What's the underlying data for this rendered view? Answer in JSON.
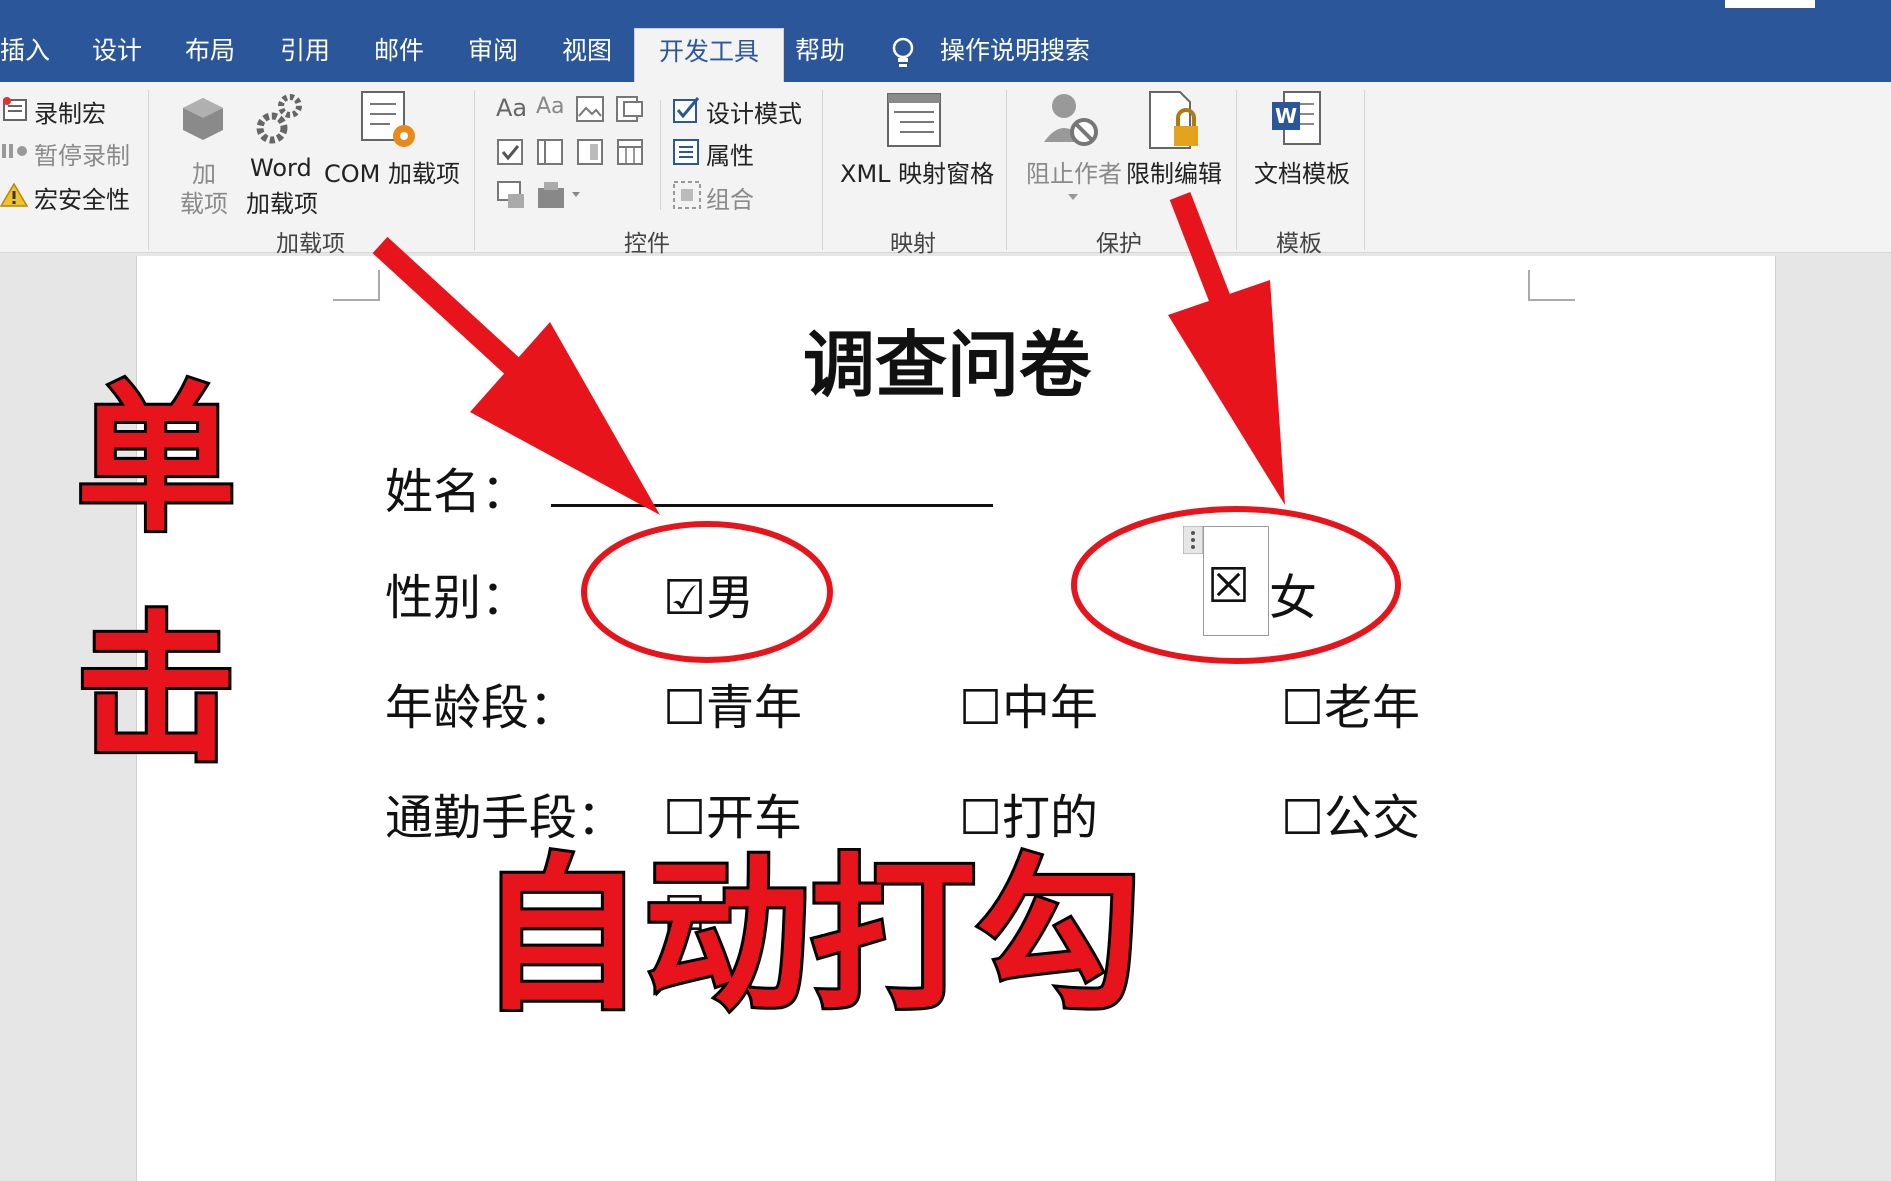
{
  "tabs": {
    "insert": "插入",
    "design": "设计",
    "layout": "布局",
    "references": "引用",
    "mailings": "邮件",
    "review": "审阅",
    "view": "视图",
    "developer": "开发工具",
    "help": "帮助",
    "tell_me": "操作说明搜索"
  },
  "ribbon": {
    "code": {
      "record_macro": "录制宏",
      "pause_recording": "暂停录制",
      "macro_security": "宏安全性"
    },
    "addins": {
      "addins_line1": "加",
      "addins_line2": "载项",
      "word_line1": "Word",
      "word_line2": "加载项",
      "com": "COM 加载项",
      "group_label": "加载项"
    },
    "controls": {
      "design_mode": "设计模式",
      "properties": "属性",
      "group": "组合",
      "aa1": "Aa",
      "aa2": "Aa",
      "group_label": "控件"
    },
    "mapping": {
      "xml_pane": "XML 映射窗格",
      "group_label": "映射"
    },
    "protect": {
      "block_authors": "阻止作者",
      "restrict_editing": "限制编辑",
      "group_label": "保护"
    },
    "templates": {
      "document_template": "文档模板",
      "group_label": "模板"
    }
  },
  "document": {
    "title": "调查问卷",
    "name_label": "姓名：",
    "gender_label": "性别：",
    "gender_male": "☑男",
    "gender_female_box": "☒",
    "gender_female": "女",
    "age_label": "年龄段：",
    "age_options": [
      "☐青年",
      "☐中年",
      "☐老年"
    ],
    "commute_label": "通勤手段：",
    "commute_options": [
      "☐开车",
      "☐打的",
      "☐公交"
    ],
    "extra_box": "☐"
  },
  "overlay": {
    "click_line1": "单",
    "click_line2": "击",
    "auto_check": "自动打勾"
  },
  "colors": {
    "tab_bar": "#2b579a",
    "ribbon": "#f3f3f3",
    "annotation_red": "#e8141c"
  }
}
